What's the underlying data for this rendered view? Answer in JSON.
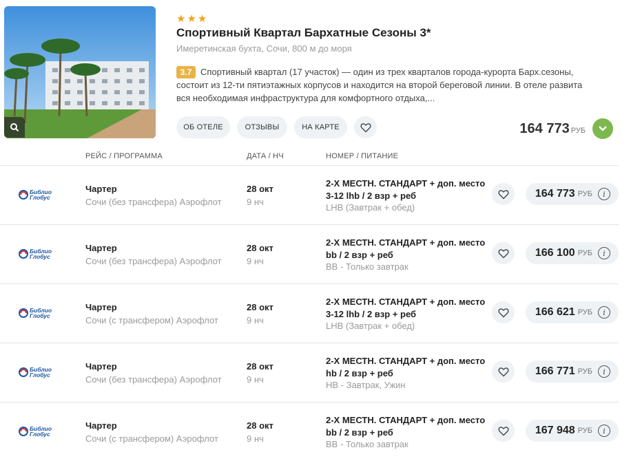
{
  "hotel": {
    "stars": 3,
    "name": "Спортивный Квартал Бархатные Сезоны 3*",
    "location": "Имеретинская бухта, Сочи, 800 м до моря",
    "rating": "3.7",
    "description": "Спортивный квартал (17 участок) — один из трех кварталов города-курорта Барх.сезоны, состоит из 12-ти пятиэтажных корпусов и находится на второй береговой линии. В отеле развита вся необходимая инфраструктура для комфортного отдыха,...",
    "buttons": {
      "about": "ОБ ОТЕЛЕ",
      "reviews": "ОТЗЫВЫ",
      "map": "НА КАРТЕ"
    },
    "price": "164 773",
    "currency": "РУБ",
    "accent_color": "#7cb84e",
    "star_color": "#f0a31c"
  },
  "table": {
    "headers": {
      "flight": "РЕЙС / ПРОГРАММА",
      "date": "ДАТА / НЧ",
      "room": "НОМЕР / ПИТАНИЕ"
    },
    "operator_logo_line1": "Библио",
    "operator_logo_line2": "Глобус",
    "rows": [
      {
        "type": "Чартер",
        "route": "Сочи (без трансфера) Аэрофлот",
        "date": "28 окт",
        "nights": "9 нч",
        "room": "2-Х МЕСТН. СТАНДАРТ + доп. место 3-12 lhb / 2 взр + реб",
        "meal": "LHB (Завтрак + обед)",
        "price": "164 773",
        "currency": "РУБ"
      },
      {
        "type": "Чартер",
        "route": "Сочи (без трансфера) Аэрофлот",
        "date": "28 окт",
        "nights": "9 нч",
        "room": "2-Х МЕСТН. СТАНДАРТ + доп. место bb / 2 взр + реб",
        "meal": "BB - Только завтрак",
        "price": "166 100",
        "currency": "РУБ"
      },
      {
        "type": "Чартер",
        "route": "Сочи (с трансфером) Аэрофлот",
        "date": "28 окт",
        "nights": "9 нч",
        "room": "2-Х МЕСТН. СТАНДАРТ + доп. место 3-12 lhb / 2 взр + реб",
        "meal": "LHB (Завтрак + обед)",
        "price": "166 621",
        "currency": "РУБ"
      },
      {
        "type": "Чартер",
        "route": "Сочи (без трансфера) Аэрофлот",
        "date": "28 окт",
        "nights": "9 нч",
        "room": "2-Х МЕСТН. СТАНДАРТ + доп. место hb / 2 взр + реб",
        "meal": "HB - Завтрак, Ужин",
        "price": "166 771",
        "currency": "РУБ"
      },
      {
        "type": "Чартер",
        "route": "Сочи (с трансфером) Аэрофлот",
        "date": "28 окт",
        "nights": "9 нч",
        "room": "2-Х МЕСТН. СТАНДАРТ + доп. место bb / 2 взр + реб",
        "meal": "BB - Только завтрак",
        "price": "167 948",
        "currency": "РУБ"
      }
    ]
  }
}
